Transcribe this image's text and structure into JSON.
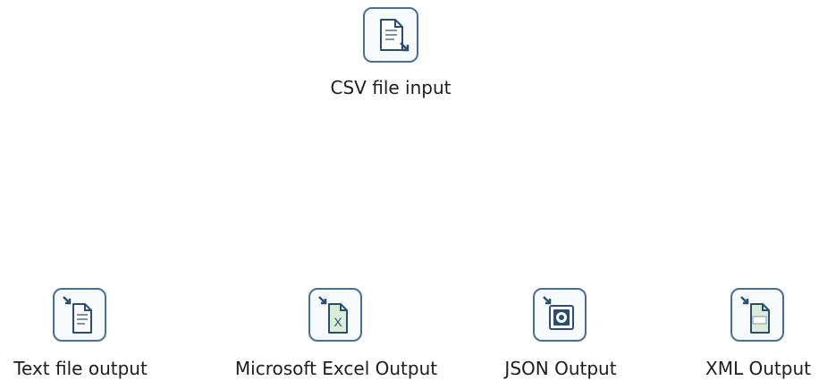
{
  "steps": [
    {
      "label": "CSV file input",
      "icon": "csv-input-icon"
    },
    {
      "label": "Text file output",
      "icon": "text-output-icon"
    },
    {
      "label": "Microsoft Excel Output",
      "icon": "excel-output-icon"
    },
    {
      "label": "JSON Output",
      "icon": "json-output-icon"
    },
    {
      "label": "XML Output",
      "icon": "xml-output-icon"
    }
  ],
  "colors": {
    "icon_border": "#4a6f90",
    "icon_accent": "#2c4e6e",
    "excel_green": "#d9edd7",
    "xml_green": "#d9edd7"
  }
}
